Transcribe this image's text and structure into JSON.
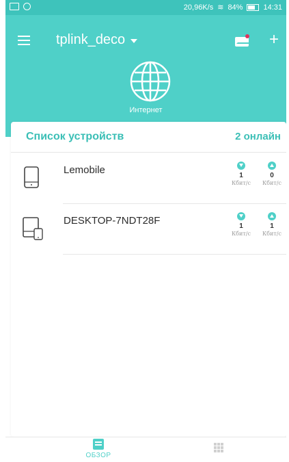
{
  "status_bar": {
    "speed": "20,96K/s",
    "battery": "84%",
    "time": "14:31"
  },
  "header": {
    "network_name": "tplink_deco",
    "internet_label": "Интернет"
  },
  "devices_card": {
    "title": "Список устройств",
    "online_count": "2 онлайн",
    "items": [
      {
        "name": "Lemobile",
        "icon": "phone-icon",
        "down_value": "1",
        "up_value": "0",
        "down_unit": "Кбит/с",
        "up_unit": "Кбит/с"
      },
      {
        "name": "DESKTOP-7NDT28F",
        "icon": "computer-phone-icon",
        "down_value": "1",
        "up_value": "1",
        "down_unit": "Кбит/с",
        "up_unit": "Кбит/с"
      }
    ]
  },
  "bottom_nav": {
    "overview_label": "ОБЗОР"
  },
  "colors": {
    "accent": "#4fd0c8",
    "title_teal": "#3bbfb6"
  }
}
